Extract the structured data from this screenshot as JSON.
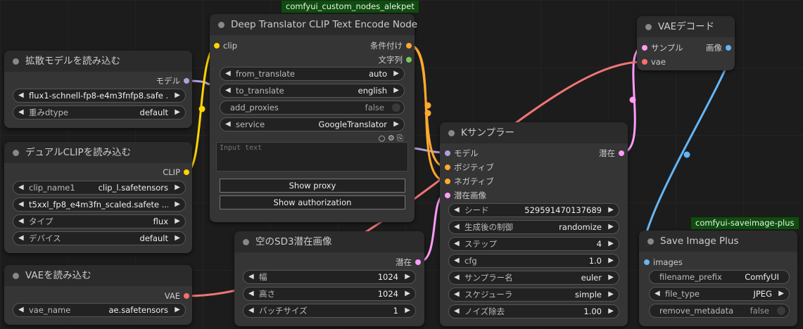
{
  "tags": {
    "alekpet": "comfyui_custom_nodes_alekpet",
    "saveplus": "comfyui-saveimage-plus"
  },
  "nodes": {
    "unet": {
      "title": "拡散モデルを読み込む",
      "out_label": "モデル",
      "model": "flux1-schnell-fp8-e4m3fnfp8.safe ...",
      "weight_label": "重みdtype",
      "weight_value": "default"
    },
    "dualclip": {
      "title": "デュアルCLIPを読み込む",
      "out_label": "CLIP",
      "clip1_label": "clip_name1",
      "clip1_value": "clip_l.safetensors",
      "clip2": "t5xxl_fp8_e4m3fn_scaled.safete ...",
      "type_label": "タイプ",
      "type_value": "flux",
      "device_label": "デバイス",
      "device_value": "default"
    },
    "vaeload": {
      "title": "VAEを読み込む",
      "out_label": "VAE",
      "vae_label": "vae_name",
      "vae_value": "ae.safetensors"
    },
    "translator": {
      "title": "Deep Translator CLIP Text Encode Node",
      "in_label": "clip",
      "out1_label": "条件付け",
      "out2_label": "文字列",
      "from_label": "from_translate",
      "from_value": "auto",
      "to_label": "to_translate",
      "to_value": "english",
      "proxies_label": "add_proxies",
      "proxies_value": "false",
      "service_label": "service",
      "service_value": "GoogleTranslator",
      "icons": "○ ⚙ ⎘",
      "placeholder": "Input text",
      "show_proxy": "Show proxy",
      "show_auth": "Show authorization"
    },
    "latent": {
      "title": "空のSD3潜在画像",
      "out_label": "潜在",
      "width_label": "幅",
      "width_value": "1024",
      "height_label": "高さ",
      "height_value": "1024",
      "batch_label": "バッチサイズ",
      "batch_value": "1"
    },
    "ksampler": {
      "title": "Kサンプラー",
      "in_model": "モデル",
      "in_pos": "ポジティブ",
      "in_neg": "ネガティブ",
      "in_latent": "潜在画像",
      "out_label": "潜在",
      "seed_label": "シード",
      "seed_value": "529591470137689",
      "control_label": "生成後の制御",
      "control_value": "randomize",
      "steps_label": "ステップ",
      "steps_value": "4",
      "cfg_label": "cfg",
      "cfg_value": "1.0",
      "sampler_label": "サンプラー名",
      "sampler_value": "euler",
      "scheduler_label": "スケジューラ",
      "scheduler_value": "simple",
      "denoise_label": "ノイズ除去",
      "denoise_value": "1.00"
    },
    "vaedecode": {
      "title": "VAEデコード",
      "in_samples": "サンプル",
      "in_vae": "vae",
      "out_label": "画像"
    },
    "saveplus": {
      "title": "Save Image Plus",
      "in_images": "images",
      "prefix_label": "filename_prefix",
      "prefix_value": "ComfyUI",
      "filetype_label": "file_type",
      "filetype_value": "JPEG",
      "meta_label": "remove_metadata",
      "meta_value": "false"
    }
  },
  "colors": {
    "model": "#b39ddb",
    "clip": "#ffd500",
    "conditioning": "#ffa931",
    "string": "#77c95a",
    "latent": "#ff9cf9",
    "vae": "#ff6e6e",
    "image": "#64b5f6"
  }
}
